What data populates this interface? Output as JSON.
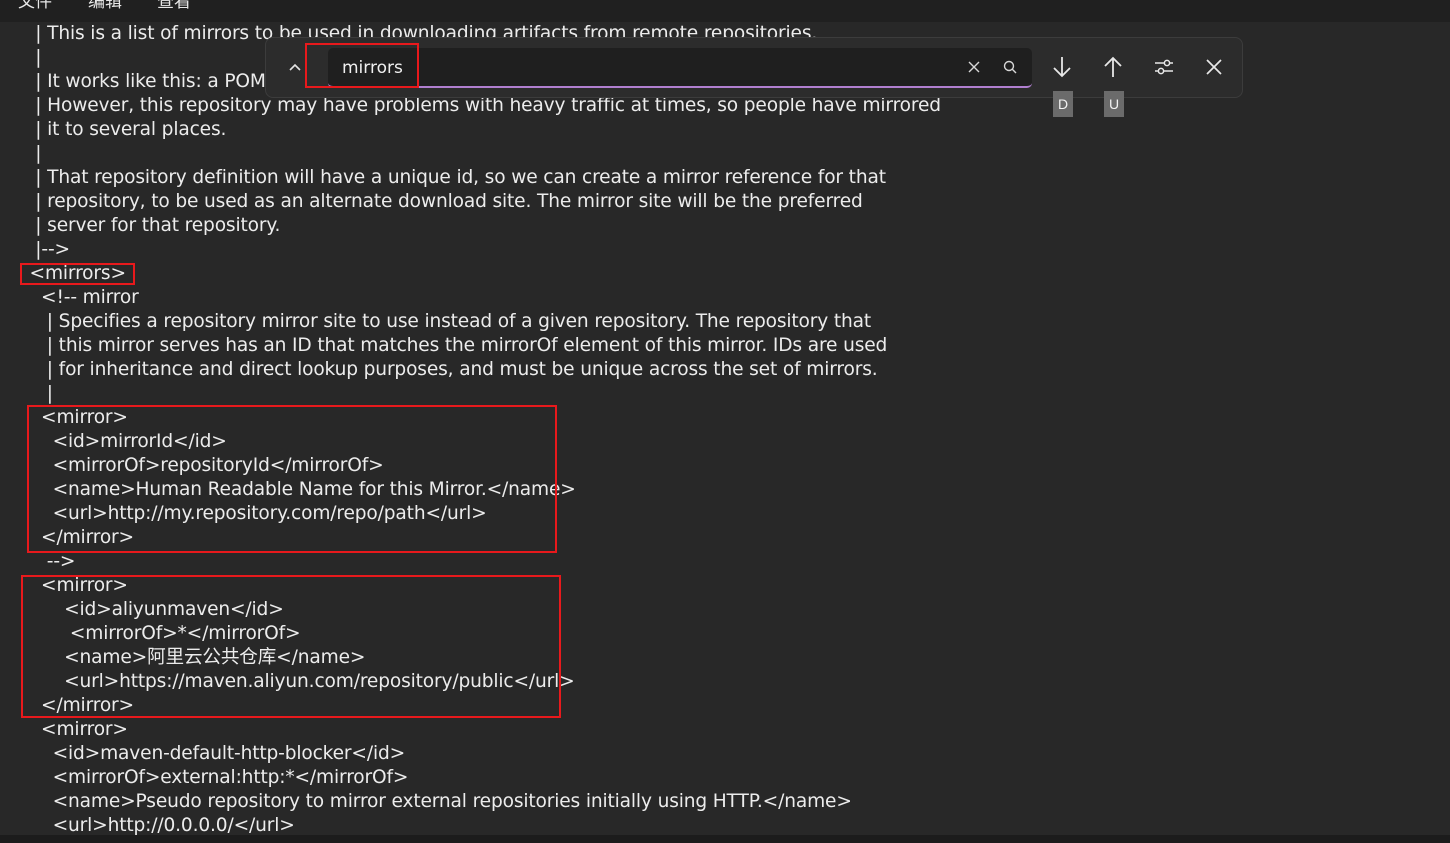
{
  "menubar": {
    "items": [
      "文件",
      "编辑",
      "查看"
    ]
  },
  "find": {
    "query": "mirrors",
    "collapse_icon": "chevron-up-icon",
    "clear_icon": "close-icon",
    "search_icon": "search-icon",
    "next_icon": "arrow-down-icon",
    "prev_icon": "arrow-up-icon",
    "options_icon": "sliders-icon",
    "close_icon": "close-icon",
    "next_key": "D",
    "prev_key": "U"
  },
  "editor": {
    "lines": [
      "   | This is a list of mirrors to be used in downloading artifacts from remote repositories.",
      "   |",
      "   | It works like this: a POM may declare a repository to use in resolving certain artifacts.",
      "   | However, this repository may have problems with heavy traffic at times, so people have mirrored",
      "   | it to several places.",
      "   |",
      "   | That repository definition will have a unique id, so we can create a mirror reference for that",
      "   | repository, to be used as an alternate download site. The mirror site will be the preferred",
      "   | server for that repository.",
      "   |-->",
      "  <mirrors>",
      "    <!-- mirror",
      "     | Specifies a repository mirror site to use instead of a given repository. The repository that",
      "     | this mirror serves has an ID that matches the mirrorOf element of this mirror. IDs are used",
      "     | for inheritance and direct lookup purposes, and must be unique across the set of mirrors.",
      "     |",
      "    <mirror>",
      "      <id>mirrorId</id>",
      "      <mirrorOf>repositoryId</mirrorOf>",
      "      <name>Human Readable Name for this Mirror.</name>",
      "      <url>http://my.repository.com/repo/path</url>",
      "    </mirror>",
      "     -->",
      "    <mirror>",
      "        <id>aliyunmaven</id>",
      "         <mirrorOf>*</mirrorOf>",
      "        <name>阿里云公共仓库</name>",
      "        <url>https://maven.aliyun.com/repository/public</url>",
      "    </mirror>",
      "    <mirror>",
      "      <id>maven-default-http-blocker</id>",
      "      <mirrorOf>external:http:*</mirrorOf>",
      "      <name>Pseudo repository to mirror external repositories initially using HTTP.</name>",
      "      <url>http://0.0.0.0/</url>"
    ]
  }
}
